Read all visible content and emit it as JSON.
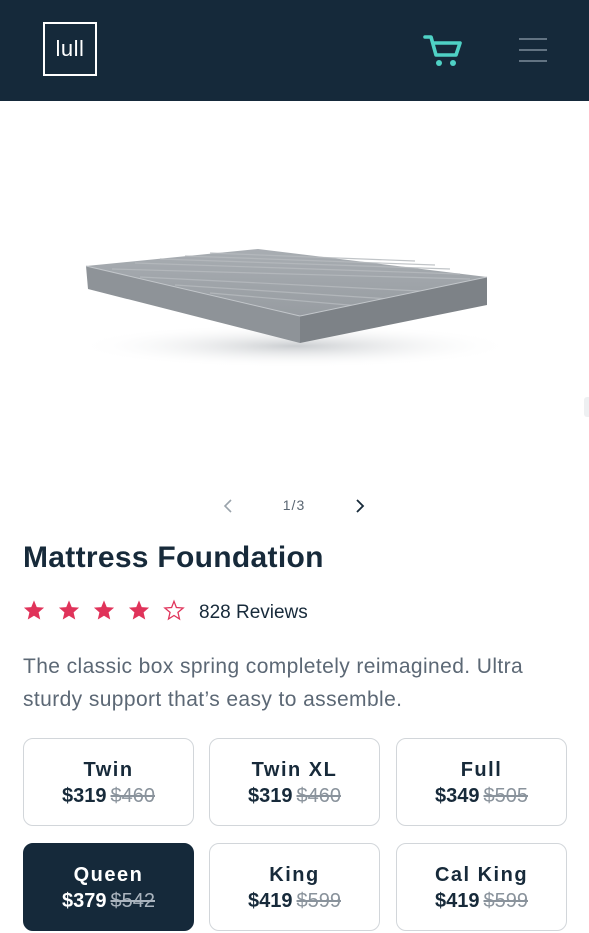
{
  "header": {
    "logo_text": "lull",
    "cart_icon": "cart-icon",
    "menu_icon": "hamburger-menu-icon",
    "background_color": "#15293a",
    "cart_color": "#4fd1c5"
  },
  "gallery": {
    "image": "mattress-foundation-photo",
    "current": "1/3"
  },
  "product": {
    "title": "Mattress Foundation",
    "rating": 4,
    "rating_max": 5,
    "reviews": "828 Reviews",
    "star_color": "#e0335a",
    "description": "The classic box spring completely reimagined. Ultra sturdy support that’s easy to assemble."
  },
  "sizes": [
    {
      "name": "Twin",
      "price": "$319",
      "original": "$460",
      "selected": false
    },
    {
      "name": "Twin XL",
      "price": "$319",
      "original": "$460",
      "selected": false
    },
    {
      "name": "Full",
      "price": "$349",
      "original": "$505",
      "selected": false
    },
    {
      "name": "Queen",
      "price": "$379",
      "original": "$542",
      "selected": true
    },
    {
      "name": "King",
      "price": "$419",
      "original": "$599",
      "selected": false
    },
    {
      "name": "Cal King",
      "price": "$419",
      "original": "$599",
      "selected": false
    }
  ]
}
